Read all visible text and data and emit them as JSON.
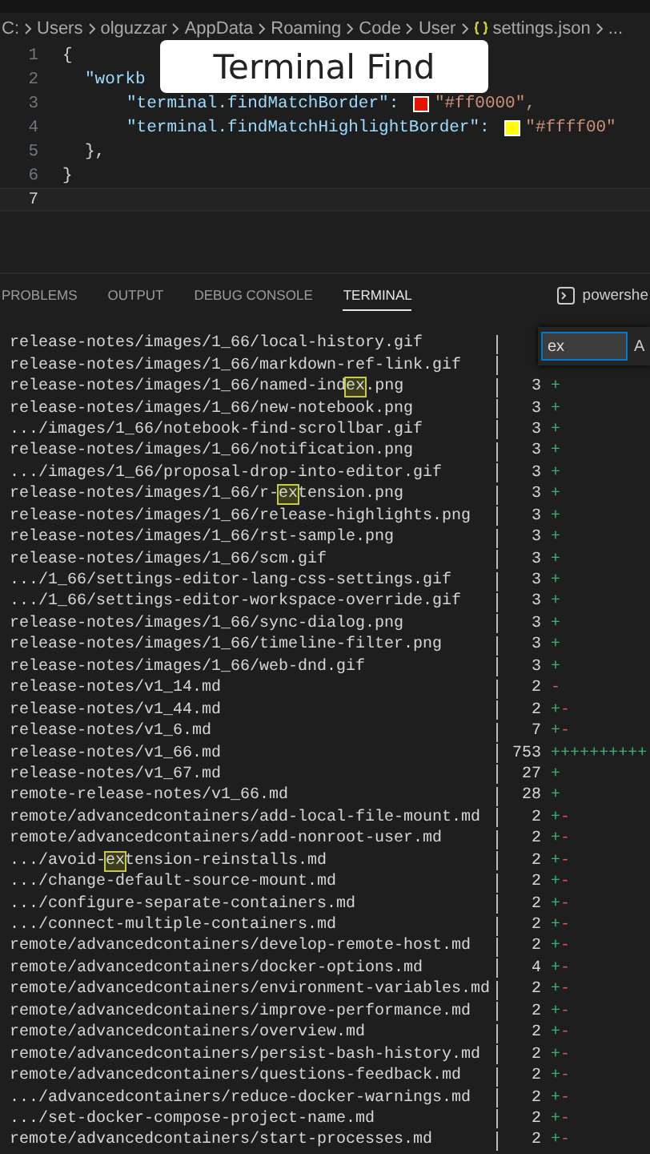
{
  "breadcrumb": [
    "C:",
    "Users",
    "olguzzar",
    "AppData",
    "Roaming",
    "Code",
    "User",
    "settings.json",
    "..."
  ],
  "editor_lines": [
    {
      "number": "1",
      "kind": "plain",
      "text": "{",
      "active": false
    },
    {
      "number": "2",
      "kind": "key",
      "text": "\"workb",
      "active": false
    },
    {
      "number": "3",
      "kind": "color",
      "key": "\"terminal.findMatchBorder\": ",
      "value": "\"#ff0000\",",
      "color": "#e51400",
      "active": false
    },
    {
      "number": "4",
      "kind": "color",
      "key": "\"terminal.findMatchHighlightBorder\": ",
      "value": "\"#ffff00\"",
      "color": "#ffff00",
      "active": false
    },
    {
      "number": "5",
      "kind": "plain",
      "text": "},",
      "active": false
    },
    {
      "number": "6",
      "kind": "plain",
      "text": "}",
      "active": false
    },
    {
      "number": "7",
      "kind": "empty",
      "active": true
    }
  ],
  "overlay_title": "Terminal Find",
  "panel_tabs": [
    {
      "label": "PROBLEMS",
      "selected": false
    },
    {
      "label": "OUTPUT",
      "selected": false
    },
    {
      "label": "DEBUG CONSOLE",
      "selected": false
    },
    {
      "label": "TERMINAL",
      "selected": true
    }
  ],
  "shell": "powershe",
  "find": {
    "value": "ex",
    "toggle": "A"
  },
  "rows": [
    {
      "path": "release-notes/images/1_66/local-history.gif"
    },
    {
      "path": "release-notes/images/1_66/markdown-ref-link.gif"
    },
    {
      "path": "release-notes/images/1_66/named-ind",
      "match": "ex",
      "after": ".png",
      "count": "3",
      "diff": "+"
    },
    {
      "path": "release-notes/images/1_66/new-notebook.png",
      "count": "3",
      "diff": "+"
    },
    {
      "path": ".../images/1_66/notebook-find-scrollbar.gif",
      "count": "3",
      "diff": "+"
    },
    {
      "path": "release-notes/images/1_66/notification.png",
      "count": "3",
      "diff": "+"
    },
    {
      "path": ".../images/1_66/proposal-drop-into-editor.gif",
      "count": "3",
      "diff": "+"
    },
    {
      "path": "release-notes/images/1_66/r-",
      "match": "ex",
      "after": "tension.png",
      "count": "3",
      "diff": "+"
    },
    {
      "path": "release-notes/images/1_66/release-highlights.png",
      "count": "3",
      "diff": "+"
    },
    {
      "path": "release-notes/images/1_66/rst-sample.png",
      "count": "3",
      "diff": "+"
    },
    {
      "path": "release-notes/images/1_66/scm.gif",
      "count": "3",
      "diff": "+"
    },
    {
      "path": ".../1_66/settings-editor-lang-css-settings.gif",
      "count": "3",
      "diff": "+"
    },
    {
      "path": ".../1_66/settings-editor-workspace-override.gif",
      "count": "3",
      "diff": "+"
    },
    {
      "path": "release-notes/images/1_66/sync-dialog.png",
      "count": "3",
      "diff": "+"
    },
    {
      "path": "release-notes/images/1_66/timeline-filter.png",
      "count": "3",
      "diff": "+"
    },
    {
      "path": "release-notes/images/1_66/web-dnd.gif",
      "count": "3",
      "diff": "+"
    },
    {
      "path": "release-notes/v1_14.md",
      "count": "2",
      "diff": "-"
    },
    {
      "path": "release-notes/v1_44.md",
      "count": "2",
      "diff": "+-"
    },
    {
      "path": "release-notes/v1_6.md",
      "count": "7",
      "diff": "+-"
    },
    {
      "path": "release-notes/v1_66.md",
      "count": "753",
      "diff": "++++++++++"
    },
    {
      "path": "release-notes/v1_67.md",
      "count": "27",
      "diff": "+"
    },
    {
      "path": "remote-release-notes/v1_66.md",
      "count": "28",
      "diff": "+"
    },
    {
      "path": "remote/advancedcontainers/add-local-file-mount.md",
      "count": "2",
      "diff": "+-"
    },
    {
      "path": "remote/advancedcontainers/add-nonroot-user.md",
      "count": "2",
      "diff": "+-"
    },
    {
      "path": ".../avoid-",
      "match": "ex",
      "after": "tension-reinstalls.md",
      "count": "2",
      "diff": "+-"
    },
    {
      "path": ".../change-default-source-mount.md",
      "count": "2",
      "diff": "+-"
    },
    {
      "path": ".../configure-separate-containers.md",
      "count": "2",
      "diff": "+-"
    },
    {
      "path": ".../connect-multiple-containers.md",
      "count": "2",
      "diff": "+-"
    },
    {
      "path": "remote/advancedcontainers/develop-remote-host.md",
      "count": "2",
      "diff": "+-"
    },
    {
      "path": "remote/advancedcontainers/docker-options.md",
      "count": "4",
      "diff": "+-"
    },
    {
      "path": "remote/advancedcontainers/environment-variables.md",
      "count": "2",
      "diff": "+-"
    },
    {
      "path": "remote/advancedcontainers/improve-performance.md",
      "count": "2",
      "diff": "+-"
    },
    {
      "path": "remote/advancedcontainers/overview.md",
      "count": "2",
      "diff": "+-"
    },
    {
      "path": "remote/advancedcontainers/persist-bash-history.md",
      "count": "2",
      "diff": "+-"
    },
    {
      "path": "remote/advancedcontainers/questions-feedback.md",
      "count": "2",
      "diff": "+-"
    },
    {
      "path": ".../advancedcontainers/reduce-docker-warnings.md",
      "count": "2",
      "diff": "+-"
    },
    {
      "path": ".../set-docker-compose-project-name.md",
      "count": "2",
      "diff": "+-"
    },
    {
      "path": "remote/advancedcontainers/start-processes.md",
      "count": "2",
      "diff": "+-"
    }
  ]
}
